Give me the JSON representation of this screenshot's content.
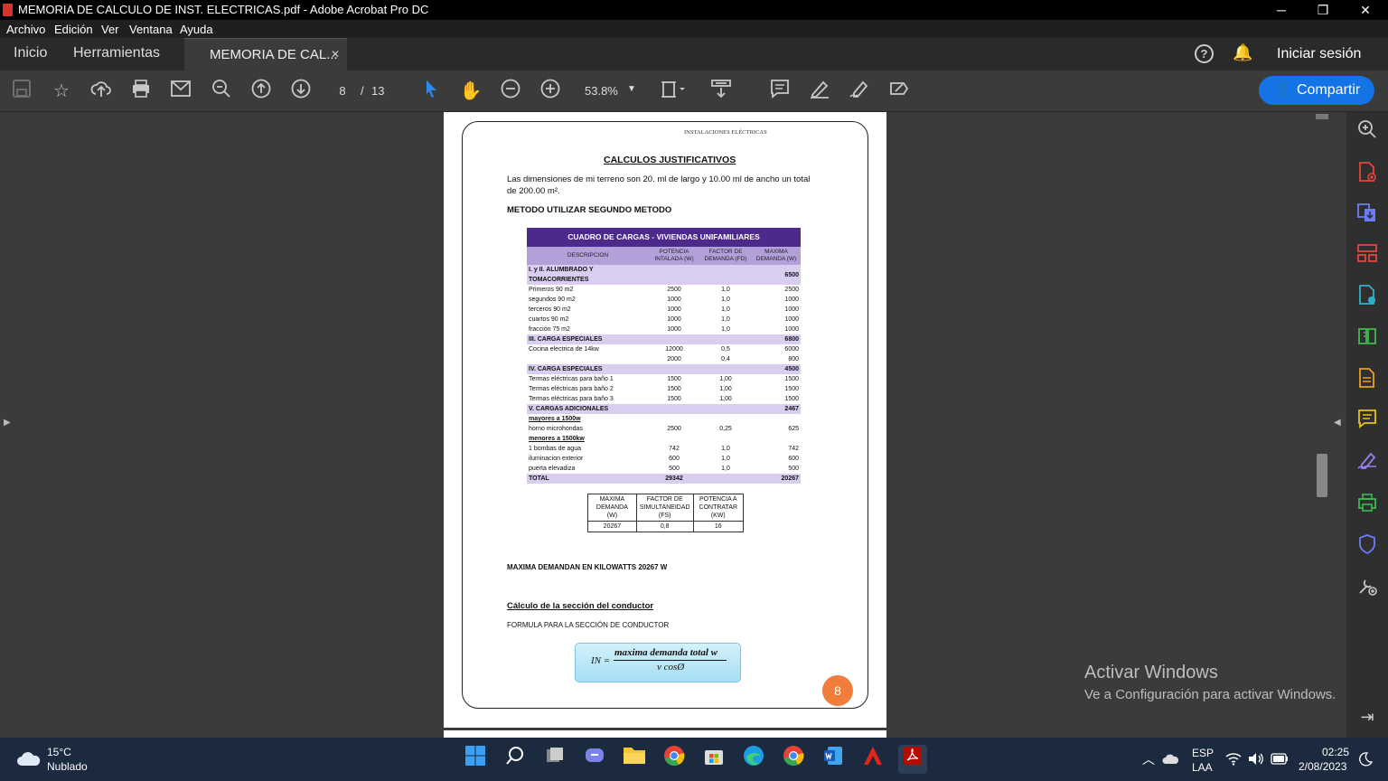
{
  "window": {
    "title": "MEMORIA DE CALCULO DE INST. ELECTRICAS.pdf - Adobe Acrobat Pro DC",
    "minimize": "─",
    "restore": "❐",
    "close": "✕"
  },
  "menu": {
    "items": [
      "Archivo",
      "Edición",
      "Ver",
      "Ventana",
      "Ayuda"
    ]
  },
  "tabs": {
    "home": "Inicio",
    "tools": "Herramientas",
    "doc": "MEMORIA DE CAL...",
    "close": "✕",
    "signin": "Iniciar sesión"
  },
  "toolbar": {
    "page_current": "8",
    "page_sep": "/",
    "page_total": "13",
    "zoom": "53.8%",
    "share": "Compartir"
  },
  "document": {
    "header": "INSTALACIONES ELÉCTRICAS",
    "title": "CALCULOS JUSTIFICATIVOS",
    "para1": "Las dimensiones de mi terreno son 20. ml de largo y 10.00 ml de ancho un total",
    "para2": "de 200.00 m².",
    "method": "METODO UTILIZAR SEGUNDO METODO",
    "table": {
      "title": "CUADRO DE CARGAS - VIVIENDAS UNIFAMILIARES",
      "headers": [
        "DESCRIPCION",
        "POTENCIA INTALADA (W)",
        "FACTOR DE DEMANDA (FD)",
        "MAXIMA DEMANDA (W)"
      ],
      "rows": [
        {
          "type": "sect",
          "cells": [
            "I. y II. ALUMBRADO Y TOMACORRIENTES",
            "",
            "",
            "6500"
          ]
        },
        {
          "type": "row",
          "cells": [
            "Primeros 90 m2",
            "2500",
            "1,0",
            "2500"
          ]
        },
        {
          "type": "row",
          "cells": [
            "segundos 90 m2",
            "1000",
            "1,0",
            "1000"
          ]
        },
        {
          "type": "row",
          "cells": [
            "terceros 90 m2",
            "1000",
            "1,0",
            "1000"
          ]
        },
        {
          "type": "row",
          "cells": [
            "cuartos 90 m2",
            "1000",
            "1,0",
            "1000"
          ]
        },
        {
          "type": "row",
          "cells": [
            "fracción 75 m2",
            "1000",
            "1,0",
            "1000"
          ]
        },
        {
          "type": "sect",
          "cells": [
            "III. CARGA ESPECIALES",
            "",
            "",
            "6800"
          ]
        },
        {
          "type": "row",
          "cells": [
            "Cocina electrica de 14kw",
            "12000",
            "0,5",
            "6000"
          ]
        },
        {
          "type": "row",
          "cells": [
            "",
            "2000",
            "0,4",
            "800"
          ]
        },
        {
          "type": "sect",
          "cells": [
            "IV. CARGA ESPECIALES",
            "",
            "",
            "4500"
          ]
        },
        {
          "type": "row",
          "cells": [
            "Termas eléctricas para baño 1",
            "1500",
            "1,00",
            "1500"
          ]
        },
        {
          "type": "row",
          "cells": [
            "Termas eléctricas para baño 2",
            "1500",
            "1,00",
            "1500"
          ]
        },
        {
          "type": "row",
          "cells": [
            "Termas eléctricas para baño 3",
            "1500",
            "1,00",
            "1500"
          ]
        },
        {
          "type": "sect",
          "cells": [
            "V. CARGAS ADICIONALES",
            "",
            "",
            "2467"
          ]
        },
        {
          "type": "ul",
          "cells": [
            "mayores a 1500w",
            "",
            "",
            ""
          ]
        },
        {
          "type": "row",
          "cells": [
            "horno microhondas",
            "2500",
            "0,25",
            "625"
          ]
        },
        {
          "type": "ul",
          "cells": [
            "menores a 1500kw",
            "",
            "",
            ""
          ]
        },
        {
          "type": "row",
          "cells": [
            "1 bombas de agua",
            "742",
            "1,0",
            "742"
          ]
        },
        {
          "type": "row",
          "cells": [
            "iluminacion exterior",
            "600",
            "1,0",
            "600"
          ]
        },
        {
          "type": "row",
          "cells": [
            "puerta elevadiza",
            "500",
            "1,0",
            "500"
          ]
        },
        {
          "type": "sect",
          "cells": [
            "TOTAL",
            "29342",
            "",
            "20267"
          ]
        }
      ]
    },
    "small_table": {
      "headers": [
        "MAXIMA DEMANDA (W)",
        "FACTOR DE SIMULTANEIDAD (FS)",
        "POTENCIA A CONTRATAR (KW)"
      ],
      "values": [
        "20267",
        "0,8",
        "16"
      ]
    },
    "max_demand": "MAXIMA DEMANDAN EN KILOWATTS 20267 W",
    "section_title": "Cálculo de la sección del conductor",
    "formula_label": "FORMULA PARA LA SECCIÓN DE CONDUCTOR",
    "formula_lhs": "IN =",
    "formula_num": "maxima demanda total w",
    "formula_den": "v cosØ",
    "page_number": "8"
  },
  "watermark": {
    "line1": "Activar Windows",
    "line2": "Ve a Configuración para activar Windows."
  },
  "taskbar": {
    "temp": "15°C",
    "weather": "Nublado",
    "lang1": "ESP",
    "lang2": "LAA",
    "time": "02:25",
    "date": "2/08/2023"
  },
  "colors": {
    "accent": "#1473e6",
    "table_header": "#4b2a8c",
    "table_sub": "#b3a0d9",
    "table_section": "#d9cef0",
    "page_badge": "#f07d3b"
  }
}
